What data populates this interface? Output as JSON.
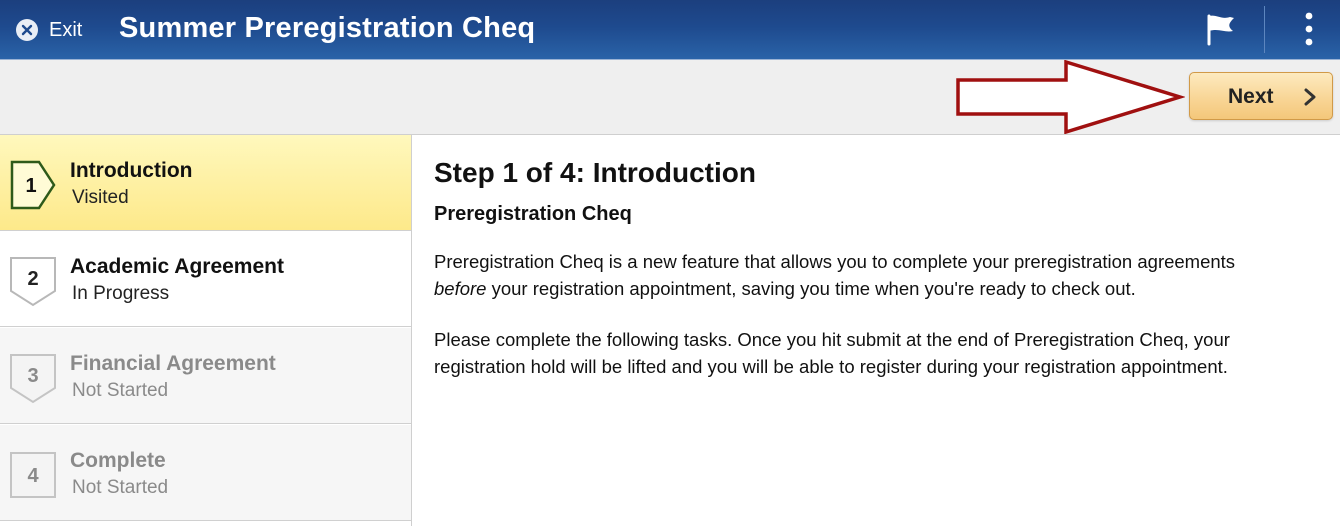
{
  "header": {
    "exit_label": "Exit",
    "title": "Summer Preregistration Cheq",
    "icons": [
      "close-icon",
      "flag-icon",
      "more-vertical-icon"
    ]
  },
  "toolbar": {
    "next_label": "Next",
    "annotation": "red-arrow pointing to Next button"
  },
  "steps": [
    {
      "number": "1",
      "title": "Introduction",
      "status": "Visited",
      "state": "active"
    },
    {
      "number": "2",
      "title": "Academic Agreement",
      "status": "In Progress",
      "state": "enabled"
    },
    {
      "number": "3",
      "title": "Financial Agreement",
      "status": "Not Started",
      "state": "disabled"
    },
    {
      "number": "4",
      "title": "Complete",
      "status": "Not Started",
      "state": "disabled"
    }
  ],
  "main": {
    "heading": "Step 1 of 4: Introduction",
    "subheading": "Preregistration Cheq",
    "para1_a": "Preregistration Cheq is a new feature that allows you to complete your preregistration agreements",
    "para1_em": "before",
    "para1_b": " your registration appointment, saving you time when you're ready to check out.",
    "para2": "Please complete the following tasks. Once you hit submit at the end of Preregistration Cheq, your registration hold will be lifted and you will be able to register during your registration appointment."
  },
  "colors": {
    "header_blue": "#1e4a8e",
    "active_step": "#fde98a",
    "next_button": "#f8d493",
    "annotation_arrow": "#a01010"
  }
}
